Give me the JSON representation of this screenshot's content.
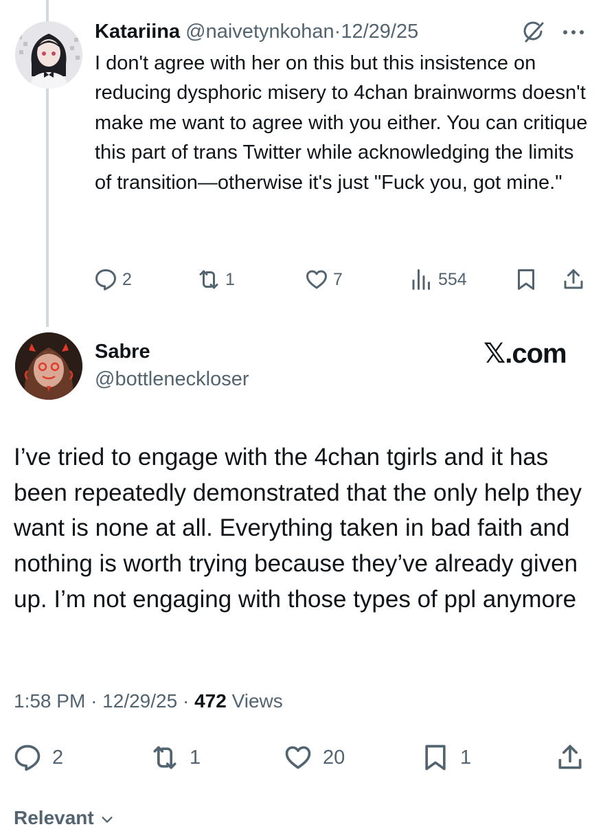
{
  "post1": {
    "name": "Katariina",
    "handle": "@naivetynkohan",
    "separator": "·",
    "date": "12/29/25",
    "text": "I don't agree with her on this but this insistence on reducing dysphoric misery to 4chan brainworms doesn't make me want to agree with you either. You can critique this part of trans Twitter while acknowledging the limits of transition—otherwise it's just \"Fuck you, got mine.\"",
    "actions": {
      "replies": "2",
      "reposts": "1",
      "likes": "7",
      "views": "554"
    }
  },
  "post2": {
    "name": "Sabre",
    "handle": "@bottleneckloser",
    "brand": "𝕏.com",
    "text": "I’ve tried to engage with the 4chan tgirls and it has been repeatedly demonstrated that the only help they want is none at all. Everything taken in bad faith and nothing is worth trying because they’ve already given up. I’m not engaging with those types of ppl anymore",
    "time": "1:58 PM",
    "date": "12/29/25",
    "separator": "·",
    "views_count": "472",
    "views_label": "Views",
    "actions": {
      "replies": "2",
      "reposts": "1",
      "likes": "20",
      "bookmarks": "1"
    }
  },
  "footer": {
    "sort_label": "Relevant"
  },
  "icons": [
    "reply-icon",
    "repost-icon",
    "like-icon",
    "views-icon",
    "bookmark-icon",
    "share-icon",
    "grok-icon",
    "more-icon",
    "chevron-down-icon"
  ],
  "colors": {
    "text": "#0f1419",
    "secondary": "#536471",
    "thread_line": "#cfd9de",
    "background": "#ffffff"
  }
}
